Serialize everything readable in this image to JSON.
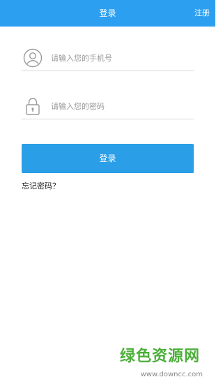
{
  "header": {
    "title": "登录",
    "register_label": "注册",
    "background": "#2d9ff0"
  },
  "form": {
    "phone": {
      "placeholder": "请输入您的手机号",
      "value": "",
      "icon": "user-avatar-icon"
    },
    "password": {
      "placeholder": "请输入您的密码",
      "value": "",
      "icon": "lock-icon"
    },
    "login_label": "登录",
    "login_color": "#2a9ee6",
    "forgot_label": "忘记密码？"
  },
  "watermark": {
    "text": "绿色资源网",
    "url": "www.downcc.com"
  }
}
